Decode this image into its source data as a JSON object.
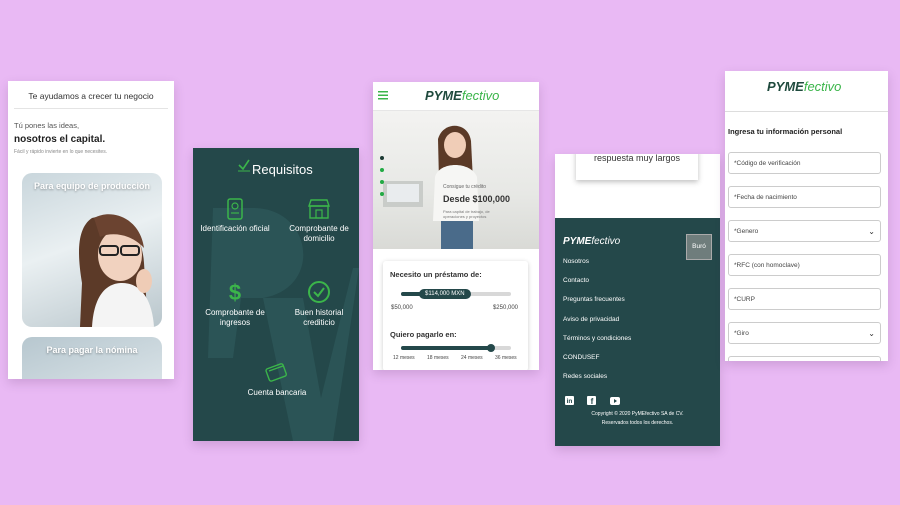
{
  "screen1": {
    "tagline": "Te ayudamos a crecer tu negocio",
    "intro": "Tú pones las ideas,",
    "capital": "nosotros el capital.",
    "small": "Fácil y rápido invierte en lo que necesites.",
    "card1_title": "Para equipo de producción",
    "card2_title": "Para pagar la nómina"
  },
  "screen2": {
    "title": "Requisitos",
    "items": [
      {
        "label": "Identificación oficial",
        "icon": "id-card-icon"
      },
      {
        "label": "Comprobante de domicilio",
        "icon": "storefront-icon"
      },
      {
        "label": "Comprobante de ingresos",
        "icon": "dollar-icon"
      },
      {
        "label": "Buen historial crediticio",
        "icon": "check-circle-icon"
      },
      {
        "label": "Cuenta bancaria",
        "icon": "bank-card-icon"
      }
    ]
  },
  "screen3": {
    "logo_main": "PYME",
    "logo_accent": "fectivo",
    "hero_small": "Consigue tu crédito",
    "hero_amount": "Desde $100,000",
    "hero_sub": "Para capital de trabajo, de operaciones y proyectos",
    "loan_question": "Necesito un préstamo de:",
    "loan_value": "$114,000 MXN",
    "loan_min": "$50,000",
    "loan_max": "$250,000",
    "loan_fraction": 0.32,
    "term_question": "Quiero pagarlo en:",
    "term_fraction": 0.82,
    "terms": [
      "12 meses",
      "18 meses",
      "24 meses",
      "36 meses"
    ]
  },
  "screen4": {
    "quote_text": "respuesta muy largos",
    "logo_main": "PYME",
    "logo_accent": "fectivo",
    "buro": "Buró",
    "links": [
      "Nosotros",
      "Contacto",
      "Preguntas frecuentes",
      "Aviso de privacidad",
      "Términos y condiciones",
      "CONDUSEF",
      "Redes sociales"
    ],
    "copyright": "Copyright © 2020 PyMEfectivo SA de CV.",
    "rights": "Reservados todos los derechos."
  },
  "screen5": {
    "logo_main": "PYME",
    "logo_accent": "fectivo",
    "title": "Ingresa tu información personal",
    "fields": [
      {
        "label": "*Código de verificación",
        "select": false
      },
      {
        "label": "*Fecha de nacimiento",
        "select": false
      },
      {
        "label": "*Genero",
        "select": true
      },
      {
        "label": "*RFC (con homoclave)",
        "select": false
      },
      {
        "label": "*CURP",
        "select": false
      },
      {
        "label": "*Giro",
        "select": true
      }
    ]
  },
  "colors": {
    "background": "#e9b9f4",
    "dark_green": "#24484a",
    "accent_green": "#3bb54a"
  }
}
